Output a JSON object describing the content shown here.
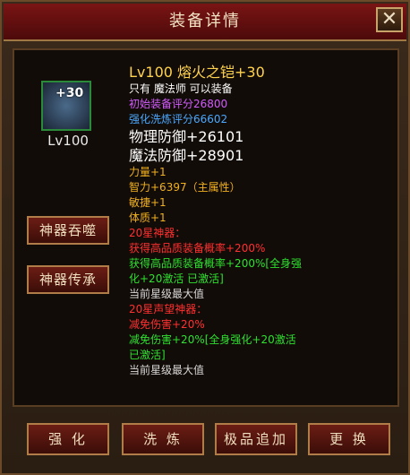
{
  "window": {
    "title": "装备详情",
    "close_icon": "close-icon"
  },
  "item": {
    "plus": "+30",
    "level": "Lv100",
    "name": "Lv100 熔火之铠+30",
    "restriction": "只有 魔法师 可以装备",
    "initial_score": "初始装备评分26800",
    "refine_score": "强化洗炼评分66602",
    "phys_def": "物理防御+26101",
    "magic_def": "魔法防御+28901",
    "strength": "力量+1",
    "intellect": "智力+6397（主属性）",
    "agility": "敏捷+1",
    "stamina": "体质+1",
    "artifact20_title": "20星神器：",
    "artifact20_effect": "获得高品质装备概率+200%",
    "artifact20_bonus_1": "获得高品质装备概率+200%[全身强",
    "artifact20_bonus_2": "化+20激活 已激活]",
    "artifact20_max": "当前星级最大值",
    "prestige20_title": "20星声望神器：",
    "prestige20_effect": "减免伤害+20%",
    "prestige20_bonus_1": "减免伤害+20%[全身强化+20激活",
    "prestige20_bonus_2": "已激活]",
    "prestige20_max": "当前星级最大值"
  },
  "side_buttons": {
    "devour": "神器吞噬",
    "inherit": "神器传承"
  },
  "bottom_buttons": {
    "enhance": "强 化",
    "wash": "洗 炼",
    "append": "极品追加",
    "replace": "更 换"
  },
  "colors": {
    "name": "#ffd34d",
    "purple": "#d35bff",
    "blue": "#4aa8ff",
    "orange": "#f0b020",
    "red": "#ff3030",
    "green": "#2fe02f",
    "white": "#ffffff",
    "gray": "#d8d8d8"
  }
}
